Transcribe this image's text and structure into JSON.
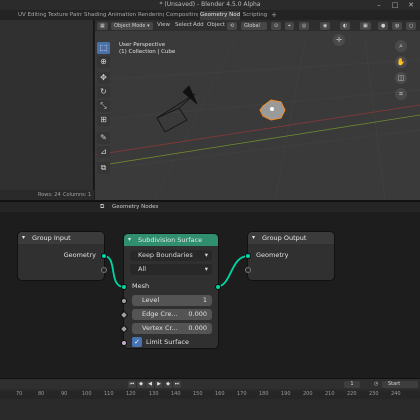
{
  "window": {
    "title": "* (Unsaved) - Blender 4.5.0 Alpha",
    "controls": {
      "minimize": "–",
      "maximize": "□",
      "close": "✕"
    }
  },
  "workspace_tabs": [
    {
      "label": "UV Editing"
    },
    {
      "label": "Texture Paint"
    },
    {
      "label": "Shading"
    },
    {
      "label": "Animation"
    },
    {
      "label": "Rendering"
    },
    {
      "label": "Compositing"
    },
    {
      "label": "Geometry Nodes",
      "active": true
    },
    {
      "label": "Scripting"
    }
  ],
  "spreadsheet": {
    "rows_label": "Rows: 24",
    "columns_label": "Columns: 1"
  },
  "viewport": {
    "mode": "Object Mode",
    "menus": [
      "View",
      "Select",
      "Add",
      "Object"
    ],
    "transform": "Global",
    "perspective_label": "User Perspective",
    "collection_label": "(1) Collection | Cube"
  },
  "node_editor": {
    "editor_name": "Geometry Nodes",
    "group_input": {
      "title": "Group Input",
      "geometry_label": "Geometry"
    },
    "subdivision": {
      "title": "Subdivision Surface",
      "boundary_option": "Keep Boundaries",
      "uv_option": "All",
      "mesh_label": "Mesh",
      "level_label": "Level",
      "level_value": "1",
      "edge_crease_label": "Edge Cre...",
      "edge_crease_value": "0.000",
      "vertex_crease_label": "Vertex Cr...",
      "vertex_crease_value": "0.000",
      "limit_surface_label": "Limit Surface",
      "limit_surface_checked": true
    },
    "group_output": {
      "title": "Group Output",
      "geometry_label": "Geometry"
    },
    "colors": {
      "geometry_header": "#2f8f6e",
      "group_header": "#3b3b3b",
      "link": "#00d6a3"
    }
  },
  "timeline": {
    "current_frame": "1",
    "start_label": "Start",
    "ruler_ticks": [
      "70",
      "80",
      "90",
      "100",
      "110",
      "120",
      "130",
      "140",
      "150",
      "160",
      "170",
      "180",
      "190",
      "200",
      "210",
      "220",
      "230",
      "240"
    ]
  }
}
